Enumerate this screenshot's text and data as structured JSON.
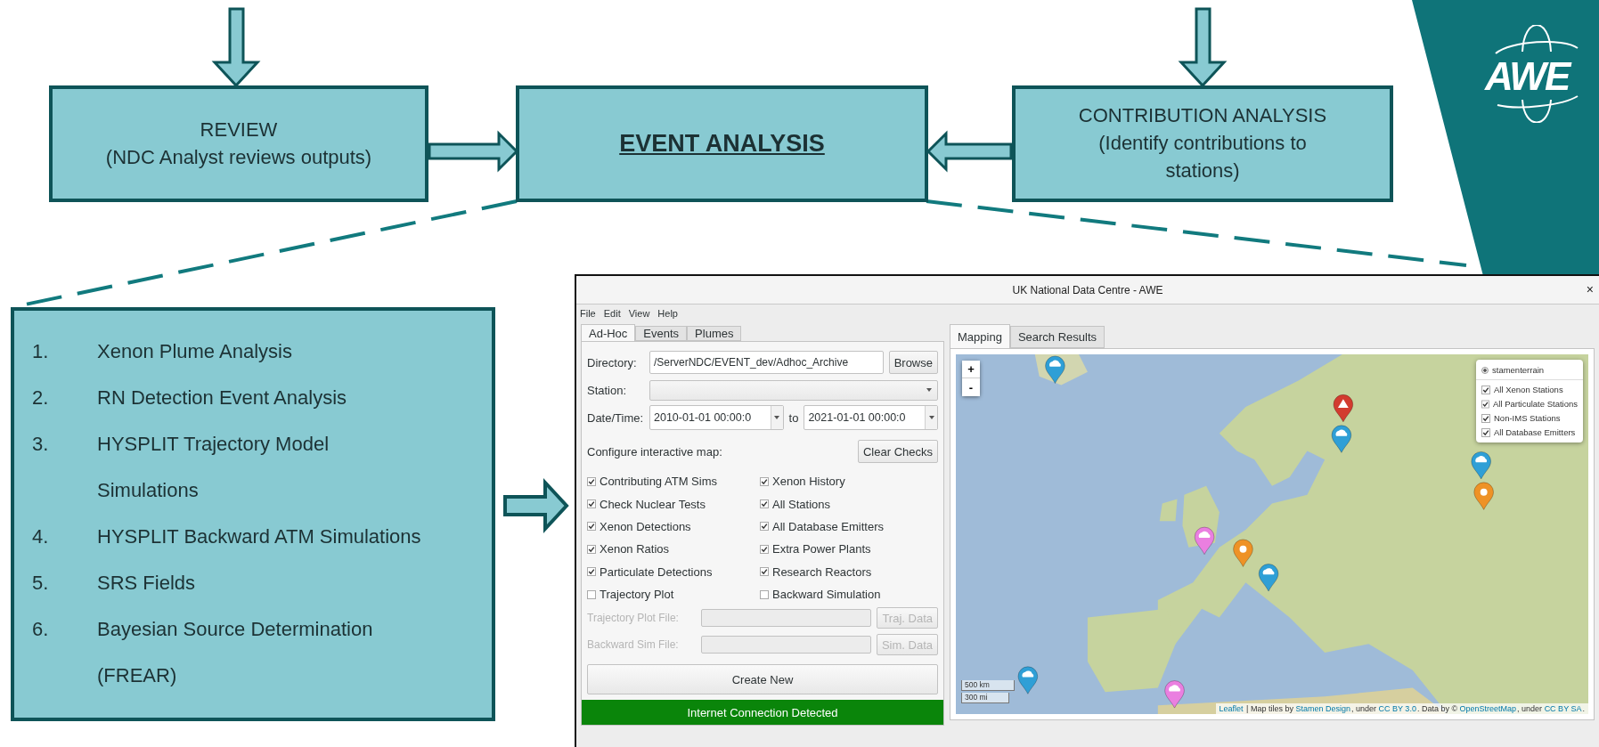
{
  "slide": {
    "review": {
      "title": "REVIEW",
      "subtitle": "(NDC Analyst reviews outputs)"
    },
    "event_analysis": {
      "title": "EVENT ANALYSIS"
    },
    "contribution": {
      "title": "CONTRIBUTION ANALYSIS",
      "subtitle": "(Identify contributions to stations)"
    },
    "steps": [
      {
        "number": "1.",
        "text": "Xenon Plume Analysis"
      },
      {
        "number": "2.",
        "text": "RN Detection Event Analysis"
      },
      {
        "number": "3.",
        "text": "HYSPLIT Trajectory Model Simulations"
      },
      {
        "number": "4.",
        "text": "HYSPLIT Backward ATM Simulations"
      },
      {
        "number": "5.",
        "text": "SRS Fields"
      },
      {
        "number": "6.",
        "text": "Bayesian Source Determination (FREAR)"
      }
    ],
    "logo": "AWE"
  },
  "window": {
    "title": "UK National Data Centre - AWE",
    "close": "×",
    "menu": [
      "File",
      "Edit",
      "View",
      "Help"
    ],
    "left_tabs": [
      {
        "label": "Ad-Hoc",
        "selected": true
      },
      {
        "label": "Events",
        "selected": false
      },
      {
        "label": "Plumes",
        "selected": false
      }
    ],
    "directory": {
      "label": "Directory:",
      "value": "/ServerNDC/EVENT_dev/Adhoc_Archive",
      "button": "Browse"
    },
    "station": {
      "label": "Station:"
    },
    "datetime": {
      "label": "Date/Time:",
      "from": "2010-01-01 00:00:0",
      "separator": "to",
      "to": "2021-01-01 00:00:0"
    },
    "configure_label": "Configure interactive map:",
    "clear_button": "Clear Checks",
    "checks": [
      {
        "label": "Contributing ATM Sims",
        "checked": true
      },
      {
        "label": "Xenon History",
        "checked": true
      },
      {
        "label": "Check Nuclear Tests",
        "checked": true
      },
      {
        "label": "All Stations",
        "checked": true
      },
      {
        "label": "Xenon Detections",
        "checked": true
      },
      {
        "label": "All Database Emitters",
        "checked": true
      },
      {
        "label": "Xenon Ratios",
        "checked": true
      },
      {
        "label": "Extra Power Plants",
        "checked": true
      },
      {
        "label": "Particulate Detections",
        "checked": true
      },
      {
        "label": "Research Reactors",
        "checked": true
      },
      {
        "label": "Trajectory Plot",
        "checked": false
      },
      {
        "label": "Backward Simulation",
        "checked": false
      }
    ],
    "files": [
      {
        "label": "Trajectory Plot File:",
        "button": "Traj. Data",
        "disabled": true
      },
      {
        "label": "Backward Sim File:",
        "button": "Sim. Data",
        "disabled": true
      }
    ],
    "create_button": "Create New",
    "status": "Internet Connection Detected",
    "right_tabs": [
      {
        "label": "Mapping",
        "selected": true
      },
      {
        "label": "Search Results",
        "selected": false
      }
    ],
    "map": {
      "zoom_in": "+",
      "zoom_out": "-",
      "base_layers": [
        {
          "label": "stamenterrain",
          "selected": true
        }
      ],
      "overlays": [
        {
          "label": "All Xenon Stations",
          "checked": true
        },
        {
          "label": "All Particulate Stations",
          "checked": true
        },
        {
          "label": "Non-IMS Stations",
          "checked": true
        },
        {
          "label": "All Database Emitters",
          "checked": true
        }
      ],
      "scale": [
        "500 km",
        "300 mi"
      ],
      "attribution": [
        {
          "text": "Leaflet",
          "link": true
        },
        {
          "text": " | Map tiles by ",
          "link": false
        },
        {
          "text": "Stamen Design",
          "link": true
        },
        {
          "text": ", under ",
          "link": false
        },
        {
          "text": "CC BY 3.0",
          "link": true
        },
        {
          "text": ". Data by © ",
          "link": false
        },
        {
          "text": "OpenStreetMap",
          "link": true
        },
        {
          "text": ", under ",
          "link": false
        },
        {
          "text": "CC BY SA",
          "link": true
        },
        {
          "text": ".",
          "link": false
        }
      ]
    }
  }
}
